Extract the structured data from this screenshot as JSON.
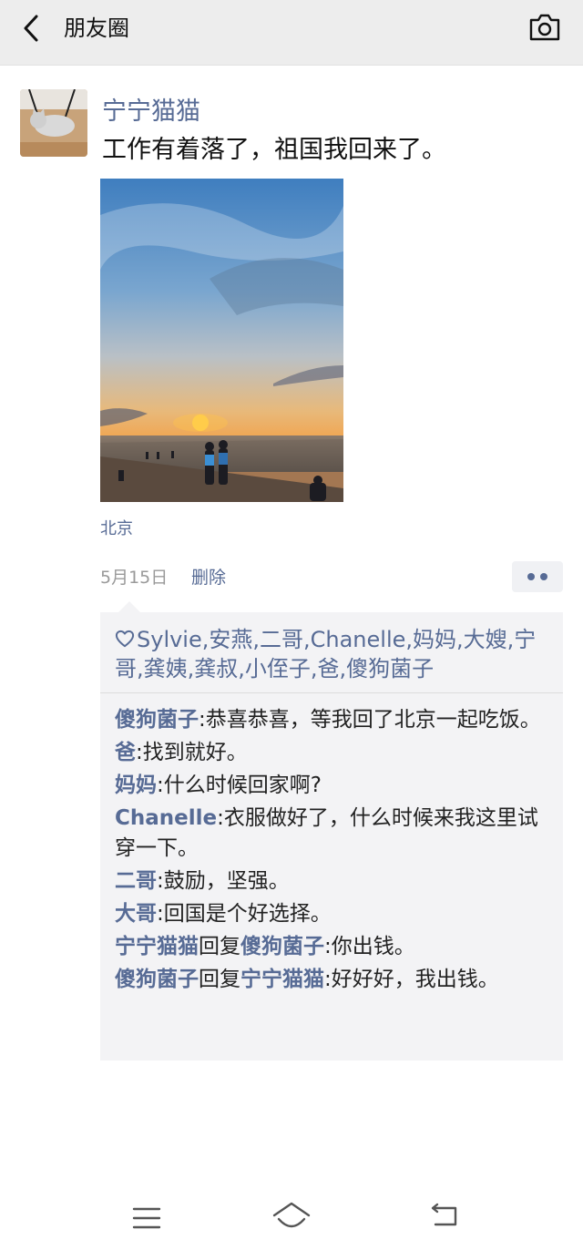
{
  "header": {
    "title": "朋友圈",
    "back_icon": "chevron-left-icon",
    "camera_icon": "camera-icon"
  },
  "post": {
    "author": "宁宁猫猫",
    "text": "工作有着落了，祖国我回来了。",
    "location": "北京",
    "date": "5月15日",
    "delete_label": "删除",
    "more_icon": "more-dots-icon"
  },
  "likes": {
    "icon": "heart-icon",
    "names": "Sylvie,安燕,二哥,Chanelle,妈妈,大嫂,宁哥,龚姨,龚叔,小侄子,爸,傻狗菌子"
  },
  "comments": [
    {
      "name": "傻狗菌子",
      "text": ":恭喜恭喜，等我回了北京一起吃饭。"
    },
    {
      "name": "爸",
      "text": ":找到就好。"
    },
    {
      "name": "妈妈",
      "text": ":什么时候回家啊?"
    },
    {
      "name": "Chanelle",
      "text": ":衣服做好了，什么时候来我这里试穿一下。"
    },
    {
      "name": "二哥",
      "text": ":鼓励，坚强。"
    },
    {
      "name": "大哥",
      "text": ":回国是个好选择。"
    },
    {
      "name": "宁宁猫猫",
      "reply_word": "回复",
      "reply_to": "傻狗菌子",
      "text": ":你出钱。"
    },
    {
      "name": "傻狗菌子",
      "reply_word": "回复",
      "reply_to": "宁宁猫猫",
      "text": ":好好好，我出钱。"
    }
  ],
  "colors": {
    "link": "#576b95",
    "header_bg": "#ededed",
    "comment_bg": "#f3f3f5"
  }
}
